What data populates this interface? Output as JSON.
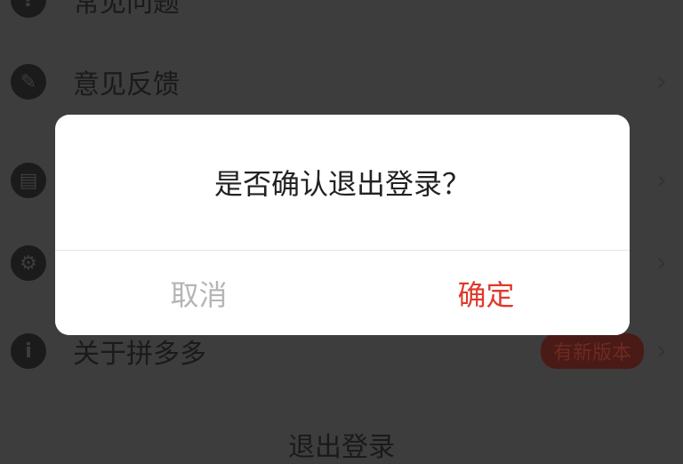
{
  "menu": {
    "items": [
      {
        "label": "常见问题",
        "icon": "question-icon",
        "glyph": "?"
      },
      {
        "label": "意见反馈",
        "icon": "feedback-pencil-icon",
        "glyph": "✎"
      },
      {
        "label": "",
        "icon": "message-icon",
        "glyph": "▤"
      },
      {
        "label": "",
        "icon": "settings-icon",
        "glyph": "⚙"
      },
      {
        "label": "关于拼多多",
        "icon": "info-icon",
        "glyph": "i",
        "badge": "有新版本"
      }
    ],
    "logout_label": "退出登录"
  },
  "dialog": {
    "message": "是否确认退出登录？",
    "cancel_label": "取消",
    "confirm_label": "确定"
  },
  "colors": {
    "overlay_bg": "#3d3d3d",
    "dialog_bg": "#ffffff",
    "cancel_text": "#b5b5b5",
    "confirm_text": "#e0392b"
  }
}
